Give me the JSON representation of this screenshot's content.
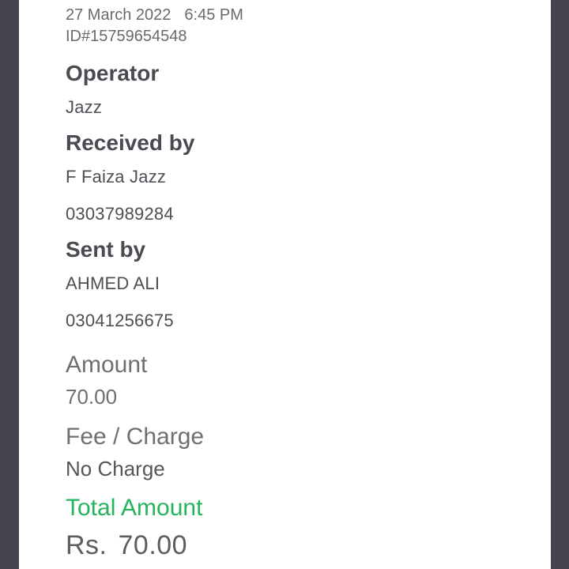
{
  "transaction": {
    "date": "27 March 2022",
    "time": "6:45 PM",
    "id": "ID#15759654548"
  },
  "operator": {
    "heading": "Operator",
    "value": "Jazz"
  },
  "received_by": {
    "heading": "Received by",
    "name": "F Faiza Jazz",
    "number": "03037989284"
  },
  "sent_by": {
    "heading": "Sent by",
    "name": "AHMED ALI",
    "number": "03041256675"
  },
  "amount": {
    "heading": "Amount",
    "value": "70.00"
  },
  "fee": {
    "heading": "Fee / Charge",
    "value": "No Charge"
  },
  "total": {
    "heading": "Total Amount",
    "currency": "Rs.",
    "value": "70.00"
  },
  "colors": {
    "background": "#45444c",
    "card": "#ffffff",
    "accent_green": "#25b35c"
  }
}
